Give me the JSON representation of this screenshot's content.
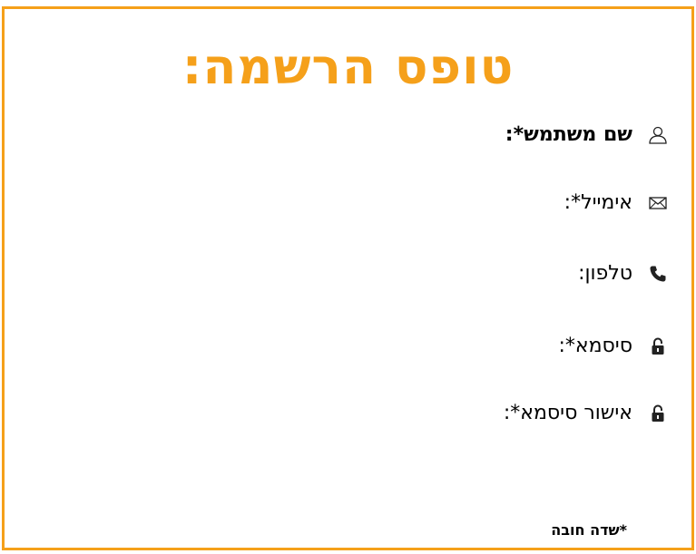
{
  "form": {
    "title": "טופס הרשמה:",
    "accent_color": "#f5a01a",
    "fields": [
      {
        "label": "שם משתמש*:",
        "icon": "user-icon"
      },
      {
        "label": "אימייל*:",
        "icon": "envelope-icon"
      },
      {
        "label": "טלפון:",
        "icon": "phone-icon"
      },
      {
        "label": "סיסמא*:",
        "icon": "lock-icon"
      },
      {
        "label": "אישור סיסמא*:",
        "icon": "lock-icon"
      }
    ],
    "required_note": "*שדה חובה"
  }
}
